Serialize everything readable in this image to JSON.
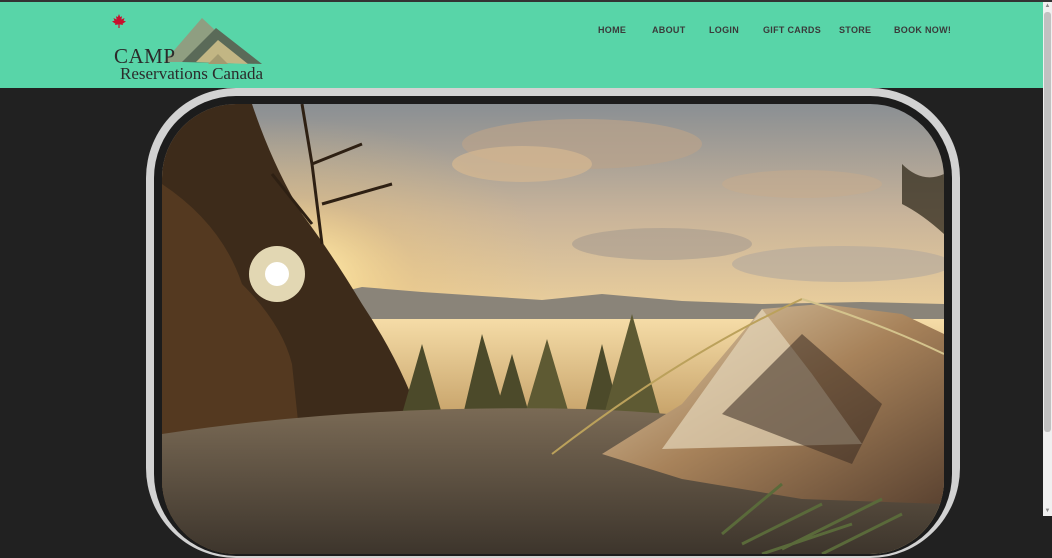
{
  "logo": {
    "line1": "CAMP",
    "line2": "Reservations Canada"
  },
  "nav": {
    "items": [
      {
        "label": "HOME"
      },
      {
        "label": "ABOUT"
      },
      {
        "label": "LOGIN"
      },
      {
        "label": "GIFT CARDS"
      },
      {
        "label": "STORE"
      },
      {
        "label": "BOOK NOW!"
      }
    ]
  },
  "colors": {
    "header_bg": "#58d5a8",
    "page_bg": "#212121",
    "frame": "#d2d2d2"
  },
  "icons": {
    "logo_mountains": "mountains-icon",
    "logo_leaf": "maple-leaf-icon"
  }
}
